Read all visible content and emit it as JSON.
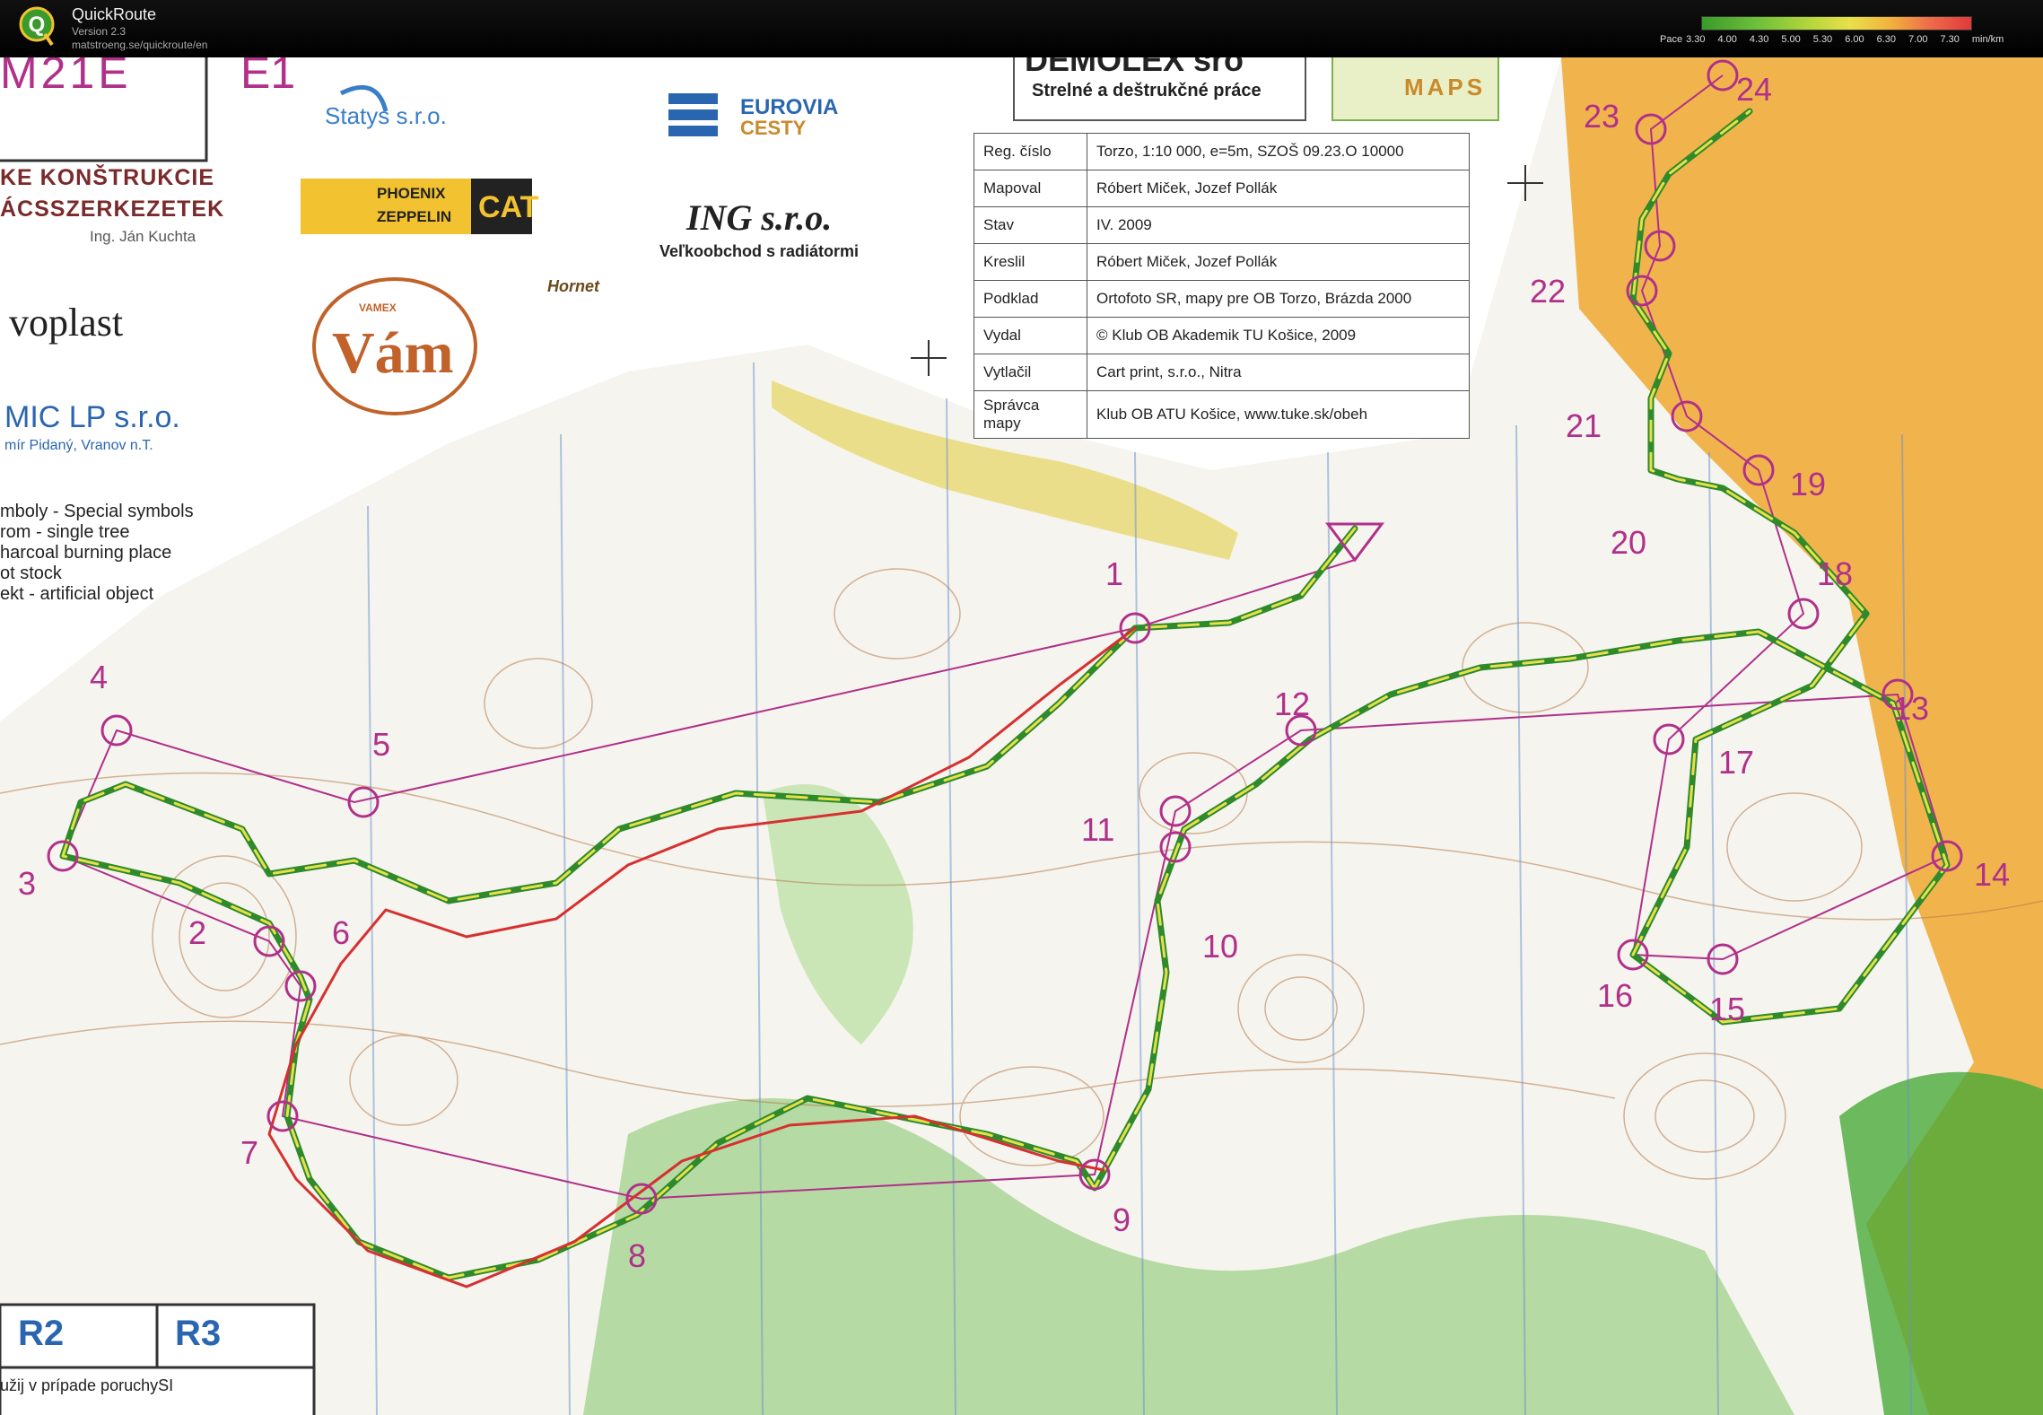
{
  "app": {
    "title": "QuickRoute",
    "version": "Version 2.3",
    "url": "matstroeng.se/quickroute/en"
  },
  "pace_legend": {
    "label": "Pace",
    "ticks": [
      "3.30",
      "4.00",
      "4.30",
      "5.00",
      "5.30",
      "6.00",
      "6.30",
      "7.00",
      "7.30"
    ],
    "unit": "min/km"
  },
  "map_texts": {
    "category": "M21E",
    "stage": "E1",
    "statys": "Statys s.r.o.",
    "eurovia_1": "EUROVIA",
    "eurovia_2": "CESTY",
    "demolex": "DEMOLEX sro",
    "demolex_sub": "Strelné a deštrukčné práce",
    "maps_badge": "MAPS",
    "phoenix_1": "PHOENIX",
    "phoenix_2": "ZEPPELIN",
    "cat": "CAT",
    "ing": "ING s.r.o.",
    "ing_sub": "Veľkoobchod s radiátormi",
    "ke_line1": "KE KONŠTRUKCIE",
    "ke_line2": "ÁCSSZERKEZETEK",
    "ke_line3": "Ing. Ján Kuchta",
    "hornet": "Hornet",
    "vam": "Vám",
    "vamex": "VAMEX",
    "voplast": "voplast",
    "mic": "MIC LP s.r.o.",
    "mic_sub": "mír Pidaný, Vranov n.T.",
    "sym_1": "mboly - Special symbols",
    "sym_2": "rom - single tree",
    "sym_3": "harcoal burning place",
    "sym_4": "ot stock",
    "sym_5": "ekt - artificial object",
    "r2": "R2",
    "r3": "R3",
    "bottom_note": "užij v prípade poruchySI"
  },
  "info_table": [
    {
      "key": "Reg. číslo",
      "value": "Torzo, 1:10 000, e=5m, SZOŠ 09.23.O 10000"
    },
    {
      "key": "Mapoval",
      "value": "Róbert Miček, Jozef Pollák"
    },
    {
      "key": "Stav",
      "value": "IV. 2009"
    },
    {
      "key": "Kreslil",
      "value": "Róbert Miček, Jozef Pollák"
    },
    {
      "key": "Podklad",
      "value": "Ortofoto SR, mapy pre OB Torzo, Brázda 2000"
    },
    {
      "key": "Vydal",
      "value": "© Klub OB Akademik TU Košice, 2009"
    },
    {
      "key": "Vytlačil",
      "value": "Cart print, s.r.o., Nitra"
    },
    {
      "key": "Správca mapy",
      "value": "Klub OB ATU Košice, www.tuke.sk/obeh"
    }
  ],
  "controls": [
    "1",
    "2",
    "3",
    "4",
    "5",
    "6",
    "7",
    "8",
    "9",
    "10",
    "11",
    "12",
    "13",
    "14",
    "15",
    "16",
    "17",
    "18",
    "19",
    "20",
    "21",
    "22",
    "23",
    "24"
  ],
  "colors": {
    "course": "#b0308a",
    "route_fast": "#2e8a2a",
    "route_mid": "#e8e04a",
    "route_slow": "#d63030",
    "paper": "#f5f4ee",
    "forest_green": "#9fd28a",
    "open_yellow": "#f0a830",
    "contour": "#b77a4a"
  }
}
